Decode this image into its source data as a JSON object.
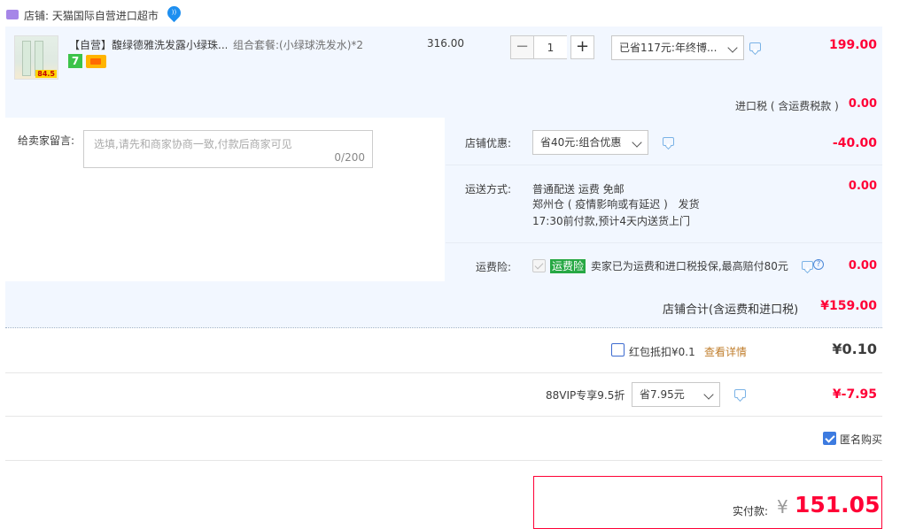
{
  "shop": {
    "label": "店铺:",
    "name": "天猫国际自营进口超市"
  },
  "item": {
    "title": "【自营】馥绿德雅洗发露小绿珠...",
    "sku": "组合套餐:(小绿球洗发水)*2",
    "unit_price": "316.00",
    "quantity": "1",
    "discount_option": "已省117元:年终博...",
    "subtotal": "199.00",
    "image_price_tag": "84.5",
    "badge_seven": "7"
  },
  "import_tax": {
    "label": "进口税 ( 含运费税款 )",
    "value": "0.00"
  },
  "message": {
    "label": "给卖家留言:",
    "placeholder": "选填,请先和商家协商一致,付款后商家可见",
    "counter": "0/200"
  },
  "shop_discount": {
    "label": "店铺优惠:",
    "option": "省40元:组合优惠",
    "value": "-40.00"
  },
  "shipping": {
    "label": "运送方式:",
    "method": "普通配送 运费 免邮",
    "warehouse": "郑州仓 ( 疫情影响或有延迟 )",
    "ship_text": "发货",
    "eta": "17:30前付款,预计4天内送货上门",
    "value": "0.00"
  },
  "insurance": {
    "label": "运费险:",
    "tag": "运费险",
    "desc": "卖家已为运费和进口税投保,最高赔付80元",
    "help": "?",
    "value": "0.00"
  },
  "shop_total": {
    "label": "店铺合计(含运费和进口税)",
    "value": "¥159.00"
  },
  "red_packet": {
    "label": "红包抵扣¥0.1",
    "link": "查看详情",
    "value": "¥0.10"
  },
  "vip": {
    "label": "88VIP专享9.5折",
    "option": "省7.95元",
    "value": "¥-7.95"
  },
  "anonymous": {
    "label": "匿名购买"
  },
  "payment": {
    "label": "实付款:",
    "currency": "¥",
    "amount": "151.05"
  },
  "colors": {
    "accent_red": "#ff0036",
    "panel_bg": "#f2f7ff",
    "link_orange": "#c07e2c"
  }
}
